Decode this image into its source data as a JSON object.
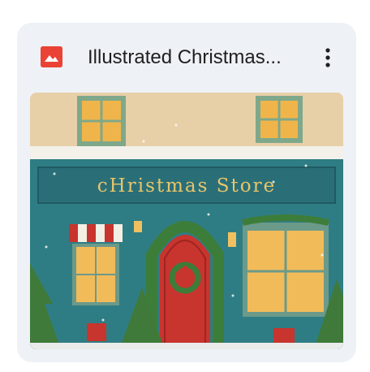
{
  "card": {
    "title": "Illustrated Christmas...",
    "file_icon": "image-file-icon",
    "more_icon": "more-vert-icon"
  },
  "thumbnail": {
    "sign_text": "cHristmas Store",
    "alt": "Illustrated Christmas store front"
  },
  "colors": {
    "card_bg": "#eef1f6",
    "file_icon": "#ea4335",
    "facade": "#2f7d84",
    "door": "#c8342e",
    "sign_text": "#e8c56a"
  }
}
